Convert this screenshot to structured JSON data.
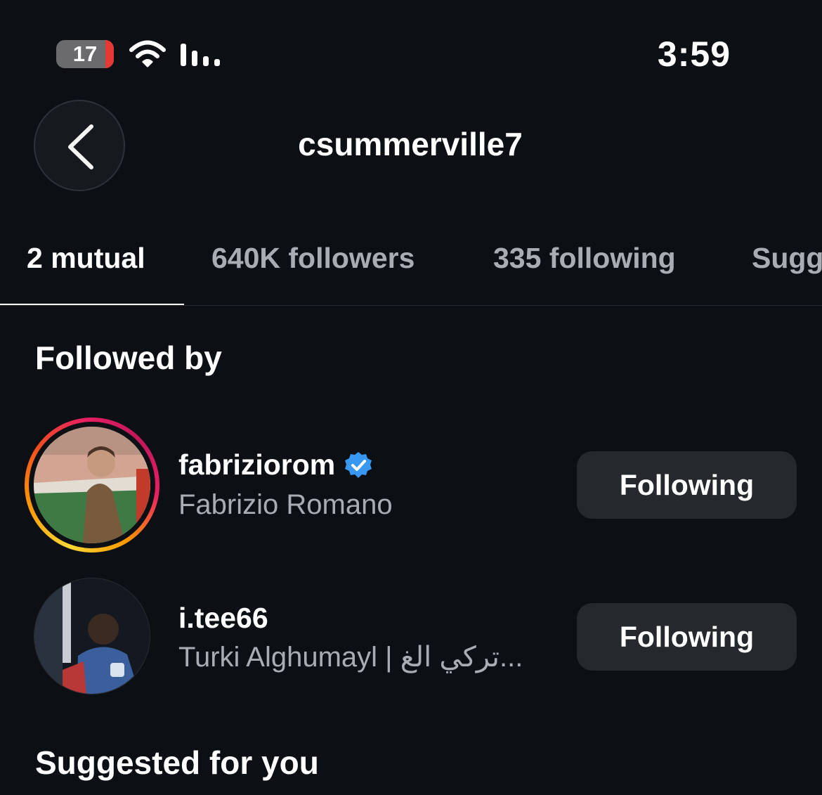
{
  "status_bar": {
    "battery": "17",
    "time": "3:59",
    "icons": [
      "battery-icon",
      "wifi-icon",
      "signal-icon"
    ]
  },
  "header": {
    "back_icon": "chevron-left-icon",
    "title": "csummerville7"
  },
  "tabs": [
    {
      "label": "2 mutual",
      "active": true
    },
    {
      "label": "640K followers",
      "active": false
    },
    {
      "label": "335 following",
      "active": false
    },
    {
      "label": "Sugg",
      "active": false
    }
  ],
  "followed_by": {
    "heading": "Followed by",
    "users": [
      {
        "username": "fabriziorom",
        "verified": true,
        "full_name": "Fabrizio Romano",
        "button": "Following",
        "has_story_ring": true
      },
      {
        "username": "i.tee66",
        "verified": false,
        "full_name": "Turki Alghumayl | تركي الغ...",
        "button": "Following",
        "has_story_ring": false
      }
    ]
  },
  "suggested": {
    "heading": "Suggested for you"
  },
  "colors": {
    "background": "#0c1014",
    "button_bg": "#25292e",
    "verified_blue": "#3897f0",
    "secondary_text": "#a8acb3"
  }
}
